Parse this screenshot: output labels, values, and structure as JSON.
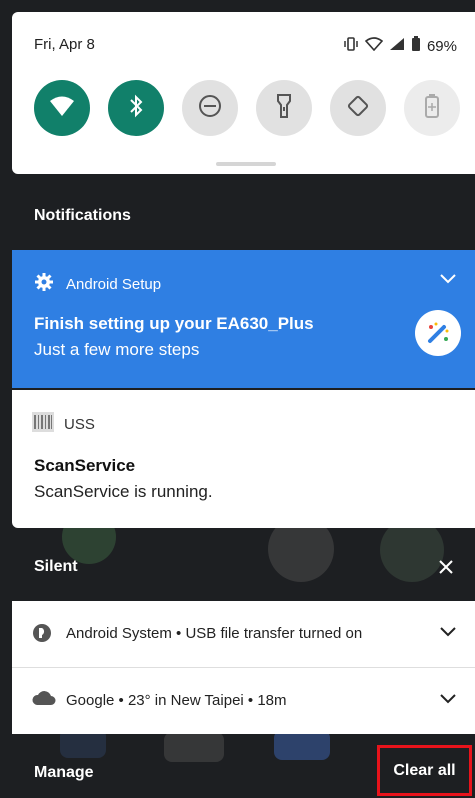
{
  "status_bar": {
    "date": "Fri, Apr 8",
    "battery": "69%"
  },
  "quick_tiles": [
    {
      "name": "wifi",
      "icon": "wifi-icon",
      "active": true
    },
    {
      "name": "bluetooth",
      "icon": "bluetooth-icon",
      "active": true
    },
    {
      "name": "do-not-disturb",
      "icon": "do-not-disturb-icon",
      "active": false
    },
    {
      "name": "flashlight",
      "icon": "flashlight-icon",
      "active": false
    },
    {
      "name": "auto-rotate",
      "icon": "auto-rotate-icon",
      "active": false
    },
    {
      "name": "battery-saver",
      "icon": "battery-saver-icon",
      "active": false
    }
  ],
  "notifications_header": "Notifications",
  "setup_card": {
    "app": "Android Setup",
    "title": "Finish setting up your EA630_Plus",
    "text": "Just a few more steps"
  },
  "uss_card": {
    "app": "USS",
    "title": "ScanService",
    "text": "ScanService is running."
  },
  "silent_header": "Silent",
  "silent_items": [
    {
      "text": "Android System • USB file transfer turned on"
    },
    {
      "text": "Google • 23° in New Taipei • 18m"
    }
  ],
  "footer": {
    "manage": "Manage",
    "clear_all": "Clear all"
  },
  "colors": {
    "accent_tile": "#11806a",
    "setup_blue": "#2f7fe3",
    "highlight_red": "#e8131b"
  }
}
